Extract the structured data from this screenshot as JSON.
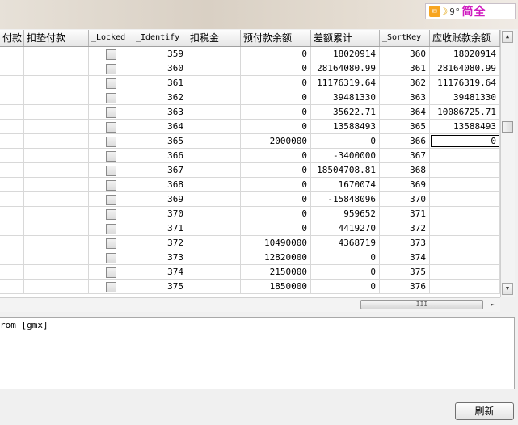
{
  "ime": {
    "punct": "9°",
    "mode": "简全"
  },
  "columns": [
    "付款",
    "扣垫付款",
    "_Locked",
    "_Identify",
    "扣税金",
    "预付款余额",
    "差额累计",
    "_SortKey",
    "应收账款余额"
  ],
  "rows": [
    {
      "locked": false,
      "identify": "359",
      "tax": "",
      "prepay": "0",
      "diff": "18020914",
      "sortkey": "360",
      "receivable": "18020914"
    },
    {
      "locked": false,
      "identify": "360",
      "tax": "",
      "prepay": "0",
      "diff": "28164080.99",
      "sortkey": "361",
      "receivable": "28164080.99"
    },
    {
      "locked": false,
      "identify": "361",
      "tax": "",
      "prepay": "0",
      "diff": "11176319.64",
      "sortkey": "362",
      "receivable": "11176319.64"
    },
    {
      "locked": false,
      "identify": "362",
      "tax": "",
      "prepay": "0",
      "diff": "39481330",
      "sortkey": "363",
      "receivable": "39481330"
    },
    {
      "locked": false,
      "identify": "363",
      "tax": "",
      "prepay": "0",
      "diff": "35622.71",
      "sortkey": "364",
      "receivable": "10086725.71"
    },
    {
      "locked": false,
      "identify": "364",
      "tax": "",
      "prepay": "0",
      "diff": "13588493",
      "sortkey": "365",
      "receivable": "13588493"
    },
    {
      "locked": false,
      "identify": "365",
      "tax": "",
      "prepay": "2000000",
      "diff": "0",
      "sortkey": "366",
      "receivable": "0"
    },
    {
      "locked": false,
      "identify": "366",
      "tax": "",
      "prepay": "0",
      "diff": "-3400000",
      "sortkey": "367",
      "receivable": ""
    },
    {
      "locked": false,
      "identify": "367",
      "tax": "",
      "prepay": "0",
      "diff": "18504708.81",
      "sortkey": "368",
      "receivable": ""
    },
    {
      "locked": false,
      "identify": "368",
      "tax": "",
      "prepay": "0",
      "diff": "1670074",
      "sortkey": "369",
      "receivable": ""
    },
    {
      "locked": false,
      "identify": "369",
      "tax": "",
      "prepay": "0",
      "diff": "-15848096",
      "sortkey": "370",
      "receivable": ""
    },
    {
      "locked": false,
      "identify": "370",
      "tax": "",
      "prepay": "0",
      "diff": "959652",
      "sortkey": "371",
      "receivable": ""
    },
    {
      "locked": false,
      "identify": "371",
      "tax": "",
      "prepay": "0",
      "diff": "4419270",
      "sortkey": "372",
      "receivable": ""
    },
    {
      "locked": false,
      "identify": "372",
      "tax": "",
      "prepay": "10490000",
      "diff": "4368719",
      "sortkey": "373",
      "receivable": ""
    },
    {
      "locked": false,
      "identify": "373",
      "tax": "",
      "prepay": "12820000",
      "diff": "0",
      "sortkey": "374",
      "receivable": ""
    },
    {
      "locked": false,
      "identify": "374",
      "tax": "",
      "prepay": "2150000",
      "diff": "0",
      "sortkey": "375",
      "receivable": ""
    },
    {
      "locked": false,
      "identify": "375",
      "tax": "",
      "prepay": "1850000",
      "diff": "0",
      "sortkey": "376",
      "receivable": ""
    }
  ],
  "selected_row": 6,
  "hscroll_label": "III",
  "log_text": "rom [gmx]",
  "refresh_label": "刷新"
}
